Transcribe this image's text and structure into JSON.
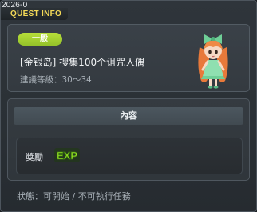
{
  "window": {
    "quest_id": "2026-0",
    "title": "QUEST INFO"
  },
  "quest": {
    "category_badge": "一般",
    "title": "[金银岛] 搜集100个诅咒人偶",
    "level_text": "建議等級：30～34",
    "npc_icon": "npc-girl-green-dress-icon"
  },
  "content": {
    "header": "內容",
    "reward_label": "獎勵",
    "reward_icon": "exp-icon"
  },
  "status_text": "狀態：可開始 / 不可執行任務",
  "colors": {
    "title_accent": "#f3d957",
    "badge_green": "#a8d335",
    "exp_green": "#9be628"
  }
}
